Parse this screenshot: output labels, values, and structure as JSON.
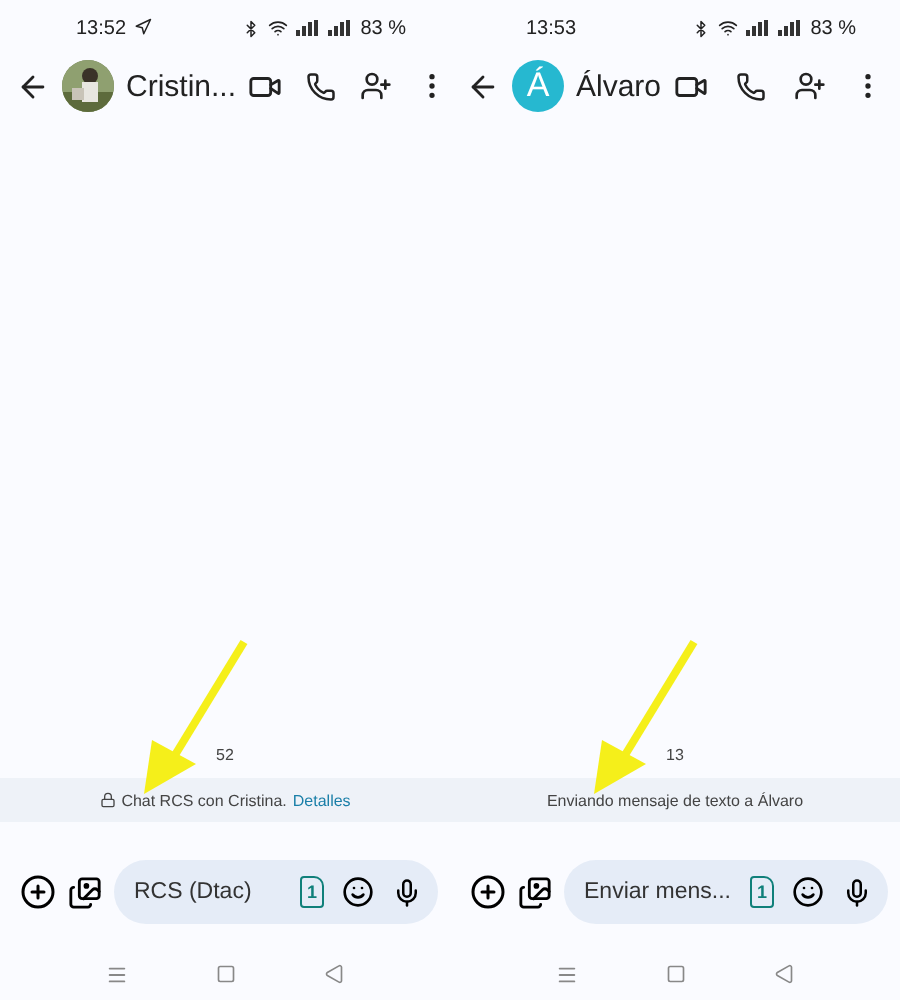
{
  "panes": [
    {
      "status_bar": {
        "time": "13:52",
        "extra_icon": true,
        "battery": "83 %"
      },
      "header": {
        "title": "Cristin..."
      },
      "timestamp": "52",
      "banner": {
        "locked": true,
        "text": "Chat RCS con Cristina.",
        "link": "Detalles"
      },
      "composer": {
        "placeholder": "RCS (Dtac)",
        "sim": "1"
      }
    },
    {
      "status_bar": {
        "time": "13:53",
        "extra_icon": false,
        "battery": "83 %"
      },
      "header": {
        "avatar": {
          "kind": "letter",
          "letter": "Á",
          "color": "#26b8d0"
        },
        "title": "Álvaro"
      },
      "timestamp": "13",
      "banner": {
        "locked": false,
        "text": "Enviando mensaje de texto a Álvaro"
      },
      "composer": {
        "placeholder": "Enviar mens...",
        "sim": "1"
      }
    }
  ]
}
